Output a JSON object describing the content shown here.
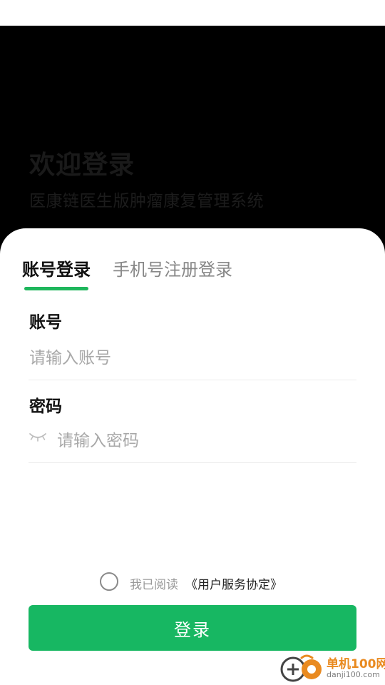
{
  "header": {
    "title": "欢迎登录",
    "subtitle": "医康链医生版肿瘤康复管理系统"
  },
  "tabs": [
    {
      "label": "账号登录",
      "active": true
    },
    {
      "label": "手机号注册登录",
      "active": false
    }
  ],
  "form": {
    "account": {
      "label": "账号",
      "placeholder": "请输入账号",
      "value": ""
    },
    "password": {
      "label": "密码",
      "placeholder": "请输入密码",
      "value": "",
      "toggle_icon": "eye-closed-icon"
    }
  },
  "agreement": {
    "checked": false,
    "text": "我已阅读",
    "link": "《用户服务协定》"
  },
  "login_button": {
    "label": "登录"
  },
  "watermark": {
    "name": "单机100网",
    "url": "danji100.com"
  },
  "colors": {
    "accent": "#17b762",
    "background_top": "#000000",
    "sheet": "#ffffff",
    "watermark": "#e98a20"
  }
}
